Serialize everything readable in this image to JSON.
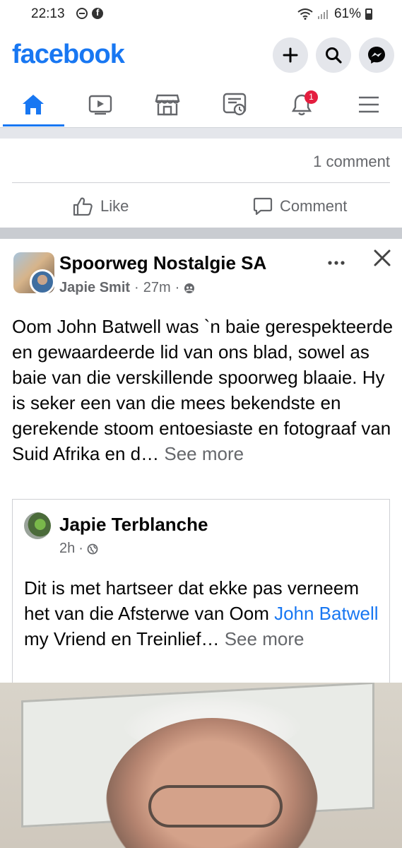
{
  "status_bar": {
    "time": "22:13",
    "battery": "61%",
    "icons": [
      "do-not-disturb-icon",
      "facebook-icon",
      "wifi-icon",
      "signal-icon",
      "battery-icon"
    ]
  },
  "header": {
    "logo": "facebook",
    "buttons": [
      "plus-icon",
      "search-icon",
      "messenger-icon"
    ]
  },
  "nav": {
    "items": [
      "home-icon",
      "video-icon",
      "marketplace-icon",
      "feeds-icon",
      "notifications-icon",
      "menu-icon"
    ],
    "active": "home",
    "notification_badge": "1"
  },
  "prev_post": {
    "comment_count": "1 comment",
    "like_label": "Like",
    "comment_label": "Comment"
  },
  "post": {
    "group_name": "Spoorweg Nostalgie SA",
    "author": "Japie Smit",
    "time": "27m",
    "body": "Oom John Batwell was `n baie gerespekteerde en gewaardeerde lid van ons blad, sowel as baie van die verskillende spoorweg blaaie. Hy is seker een van die mees bekendste en gerekende stoom entoesiaste en fotograaf van Suid Afrika en d…",
    "see_more": "See more",
    "shared": {
      "name": "Japie Terblanche",
      "time": "2h",
      "body_before": "Dit is met hartseer dat ekke pas verneem het van die Afsterwe van Oom ",
      "link": "John Batwell",
      "body_after": " my Vriend en Treinlief…",
      "see_more": "See more"
    }
  },
  "colors": {
    "brand": "#1877f2",
    "secondary_text": "#65676b",
    "badge": "#e41e3f"
  }
}
